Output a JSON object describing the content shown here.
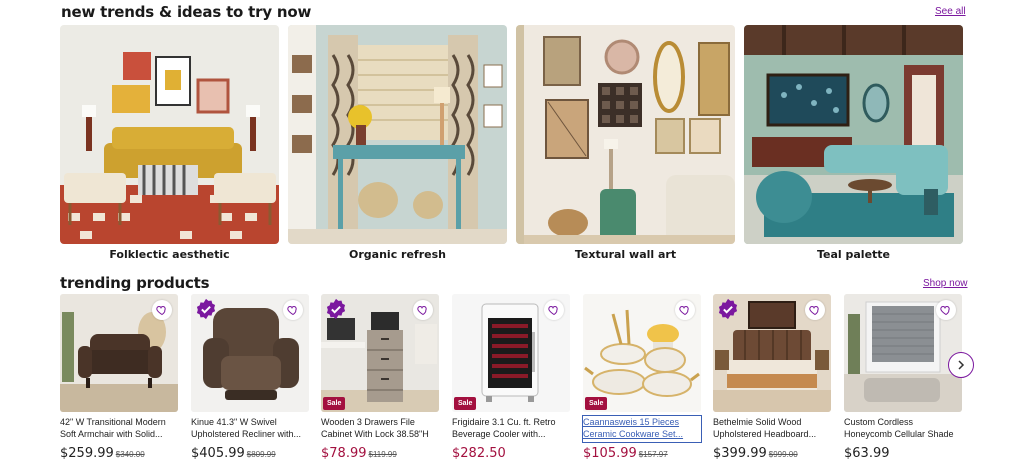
{
  "trends": {
    "title": "new trends & ideas to try now",
    "see_all": "See all",
    "items": [
      {
        "label": "Folklectic aesthetic"
      },
      {
        "label": "Organic refresh"
      },
      {
        "label": "Textural wall art"
      },
      {
        "label": "Teal palette"
      }
    ]
  },
  "products": {
    "title": "trending products",
    "shop_now": "Shop now",
    "items": [
      {
        "name": "42\" W Transitional Modern Soft Armchair with Solid...",
        "price": "$259.99",
        "was": "$340.00",
        "sale": "",
        "badge": false
      },
      {
        "name": "Kinue 41.3\" W Swivel Upholstered Recliner with...",
        "price": "$405.99",
        "was": "$809.99",
        "sale": "",
        "badge": true
      },
      {
        "name": "Wooden 3 Drawers File Cabinet With Lock 38.58\"H",
        "price": "$78.99",
        "was": "$119.99",
        "sale": "Sale",
        "badge": true
      },
      {
        "name": "Frigidaire 3.1 Cu. ft. Retro Beverage Cooler with...",
        "price": "$282.50",
        "was": "",
        "sale": "Sale",
        "badge": false
      },
      {
        "name": "Caannasweis 15 Pieces Ceramic Cookware Set...",
        "price": "$105.99",
        "was": "$157.97",
        "sale": "Sale",
        "badge": false
      },
      {
        "name": "Bethelmie Solid Wood Upholstered Headboard...",
        "price": "$399.99",
        "was": "$999.00",
        "sale": "",
        "badge": true
      },
      {
        "name": "Custom Cordless Honeycomb Cellular Shade",
        "price": "$63.99",
        "was": "",
        "sale": "",
        "badge": false
      }
    ]
  },
  "colors": {
    "accent": "#7b189f",
    "sale": "#a3103f"
  },
  "icons": {
    "heart": "heart-icon",
    "next": "chevron-right-icon",
    "badge": "verified-badge-icon"
  }
}
